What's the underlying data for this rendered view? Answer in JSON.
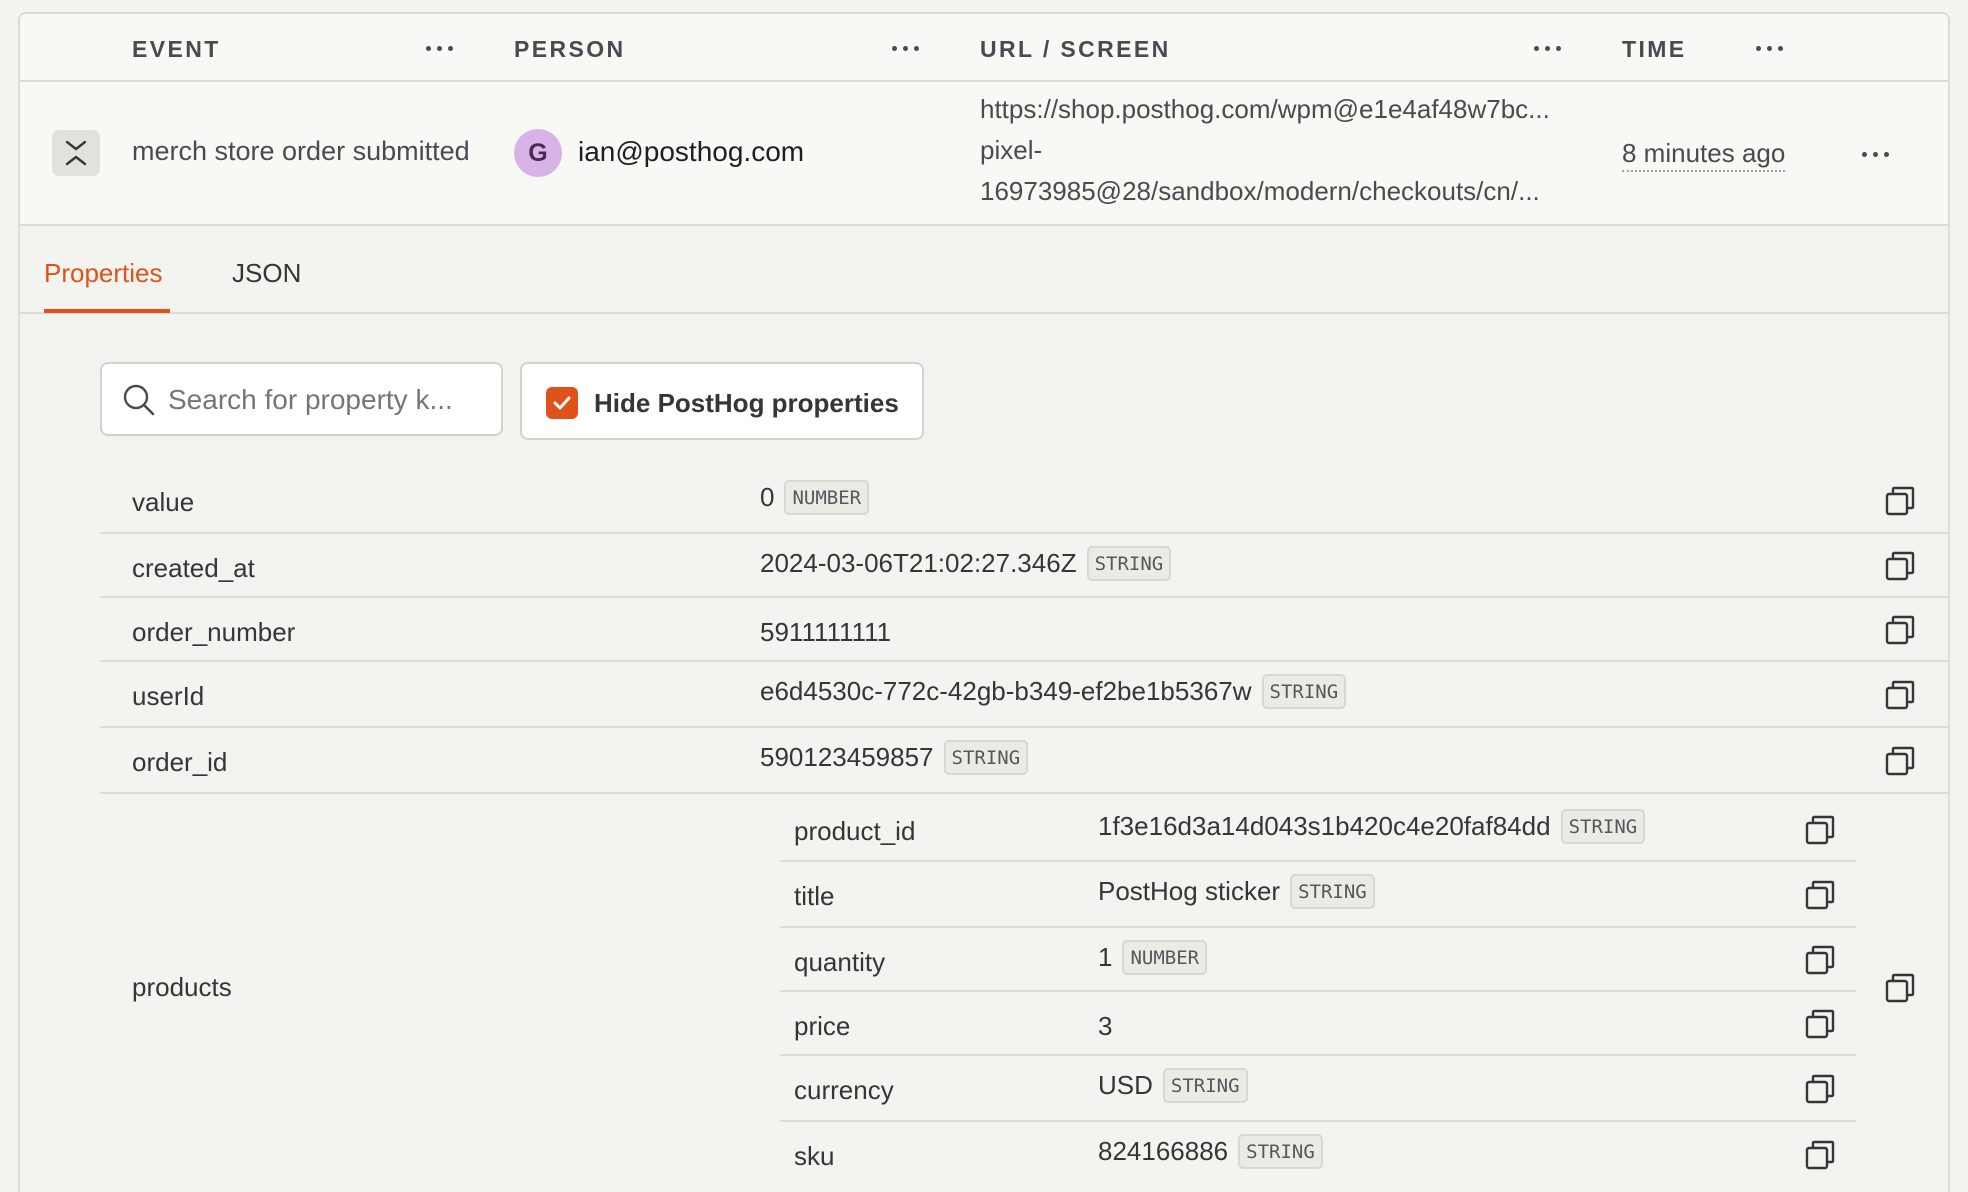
{
  "columns": {
    "event": "EVENT",
    "person": "PERSON",
    "url": "URL / SCREEN",
    "time": "TIME"
  },
  "event_row": {
    "event_name": "merch store order submitted",
    "person_initial": "G",
    "person_email": "ian@posthog.com",
    "url_lines": [
      "https://shop.posthog.com/wpm@e1e4af48w7bc...",
      "pixel-",
      "16973985@28/sandbox/modern/checkouts/cn/..."
    ],
    "time": "8 minutes ago"
  },
  "tabs": [
    {
      "label": "Properties",
      "active": true
    },
    {
      "label": "JSON",
      "active": false
    }
  ],
  "search": {
    "placeholder": "Search for property k..."
  },
  "hide_posthog": {
    "label": "Hide PostHog properties",
    "checked": true
  },
  "properties": [
    {
      "key": "value",
      "value": "0",
      "type": "NUMBER"
    },
    {
      "key": "created_at",
      "value": "2024-03-06T21:02:27.346Z",
      "type": "STRING"
    },
    {
      "key": "order_number",
      "value": "5911111111",
      "type": ""
    },
    {
      "key": "userId",
      "value": "e6d4530c-772c-42gb-b349-ef2be1b5367w",
      "type": "STRING"
    },
    {
      "key": "order_id",
      "value": "590123459857",
      "type": "STRING"
    }
  ],
  "products": {
    "key": "products",
    "items": [
      {
        "key": "product_id",
        "value": "1f3e16d3a14d043s1b420c4e20faf84dd",
        "type": "STRING"
      },
      {
        "key": "title",
        "value": "PostHog sticker",
        "type": "STRING"
      },
      {
        "key": "quantity",
        "value": "1",
        "type": "NUMBER"
      },
      {
        "key": "price",
        "value": "3",
        "type": ""
      },
      {
        "key": "currency",
        "value": "USD",
        "type": "STRING"
      },
      {
        "key": "sku",
        "value": "824166886",
        "type": "STRING"
      }
    ]
  },
  "colors": {
    "accent": "#e0521b",
    "avatar": "#d7b3e8"
  }
}
